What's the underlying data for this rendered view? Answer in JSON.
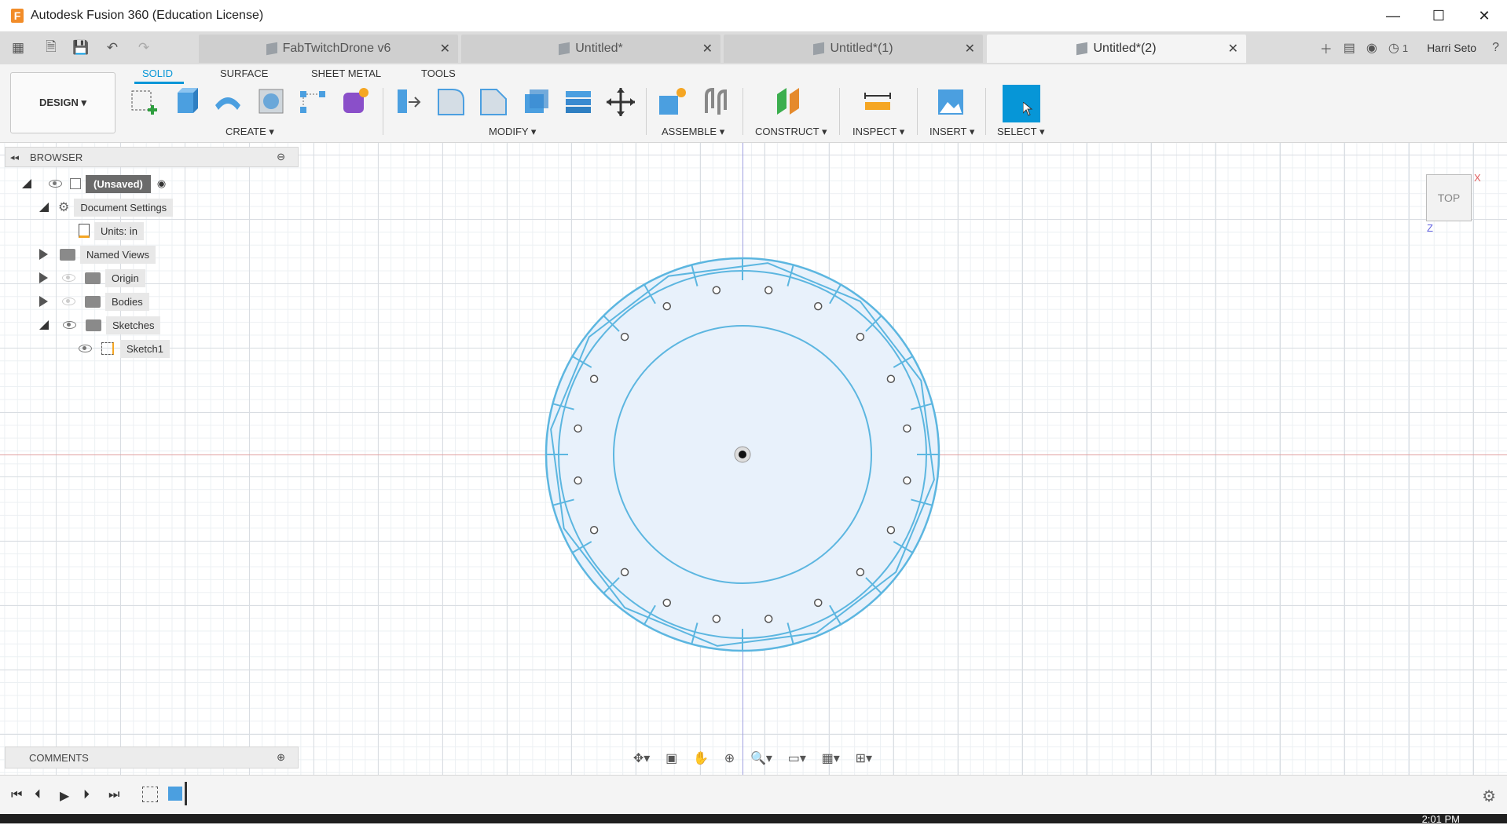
{
  "window": {
    "title": "Autodesk Fusion 360 (Education License)",
    "minimize": "—",
    "maximize": "☐",
    "close": "✕"
  },
  "tabs": [
    {
      "label": "FabTwitchDrone v6"
    },
    {
      "label": "Untitled*"
    },
    {
      "label": "Untitled*(1)"
    },
    {
      "label": "Untitled*(2)"
    }
  ],
  "topbar": {
    "notifications": "1",
    "user": "Harri Seto",
    "help": "?"
  },
  "ribbon": {
    "tabs": [
      "SOLID",
      "SURFACE",
      "SHEET METAL",
      "TOOLS"
    ],
    "workspace": "DESIGN ▾",
    "groups": [
      "CREATE ▾",
      "MODIFY ▾",
      "ASSEMBLE ▾",
      "CONSTRUCT ▾",
      "INSPECT ▾",
      "INSERT ▾",
      "SELECT ▾"
    ]
  },
  "browser": {
    "title": "BROWSER",
    "root": "(Unsaved)",
    "items": [
      "Document Settings",
      "Units: in",
      "Named Views",
      "Origin",
      "Bodies",
      "Sketches",
      "Sketch1"
    ]
  },
  "viewcube": {
    "label": "TOP",
    "x": "X",
    "z": "Z"
  },
  "comments": {
    "title": "COMMENTS"
  },
  "clock": {
    "time": "2:01 PM"
  },
  "colors": {
    "accent": "#0696d7",
    "sketch": "#5cb6e0",
    "fill": "#e8f1fb"
  }
}
